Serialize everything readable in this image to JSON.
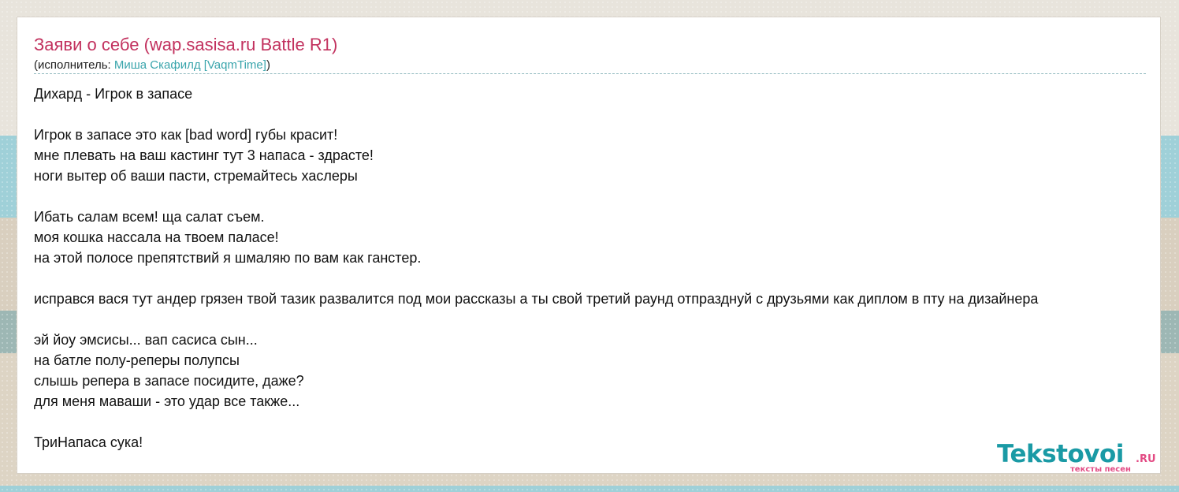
{
  "song": {
    "title": "Заяви о себе (wap.sasisa.ru Battle R1)",
    "artist_prefix": "(исполнитель: ",
    "artist_name": "Миша Скафилд [VaqmTime]",
    "artist_suffix": ")"
  },
  "lyrics": [
    "Дихард - Игрок в запасе",
    "",
    "Игрок в запасе это как [bad word] губы красит!",
    "мне плевать на ваш кастинг тут 3 напаса - здрасте!",
    "ноги вытер об ваши пасти, стремайтесь хаслеры",
    "",
    "Ибать салам всем! ща салат съем.",
    "моя кошка нассала на твоем паласе!",
    "на этой полосе препятствий я шмаляю по вам как ганстер.",
    "",
    "исправся вася тут андер грязен твой тазик развалится под мои рассказы а ты свой третий раунд отпразднуй с друзьями как диплом в пту на дизайнера",
    "",
    "эй йоу эмсисы... вап сасиса сын...",
    "на батле полу-реперы полупсы",
    "слышь репера в запасе посидите, даже?",
    "для меня маваши - это удар все также...",
    "",
    "ТриНапаса сука!"
  ],
  "logo": {
    "main": "Tekstovoi",
    "domain": ".RU",
    "tagline": "тексты песен"
  },
  "colors": {
    "title": "#c2315e",
    "link": "#3aa5ac",
    "logo_main": "#1a9aa5",
    "logo_accent": "#e34b84"
  }
}
